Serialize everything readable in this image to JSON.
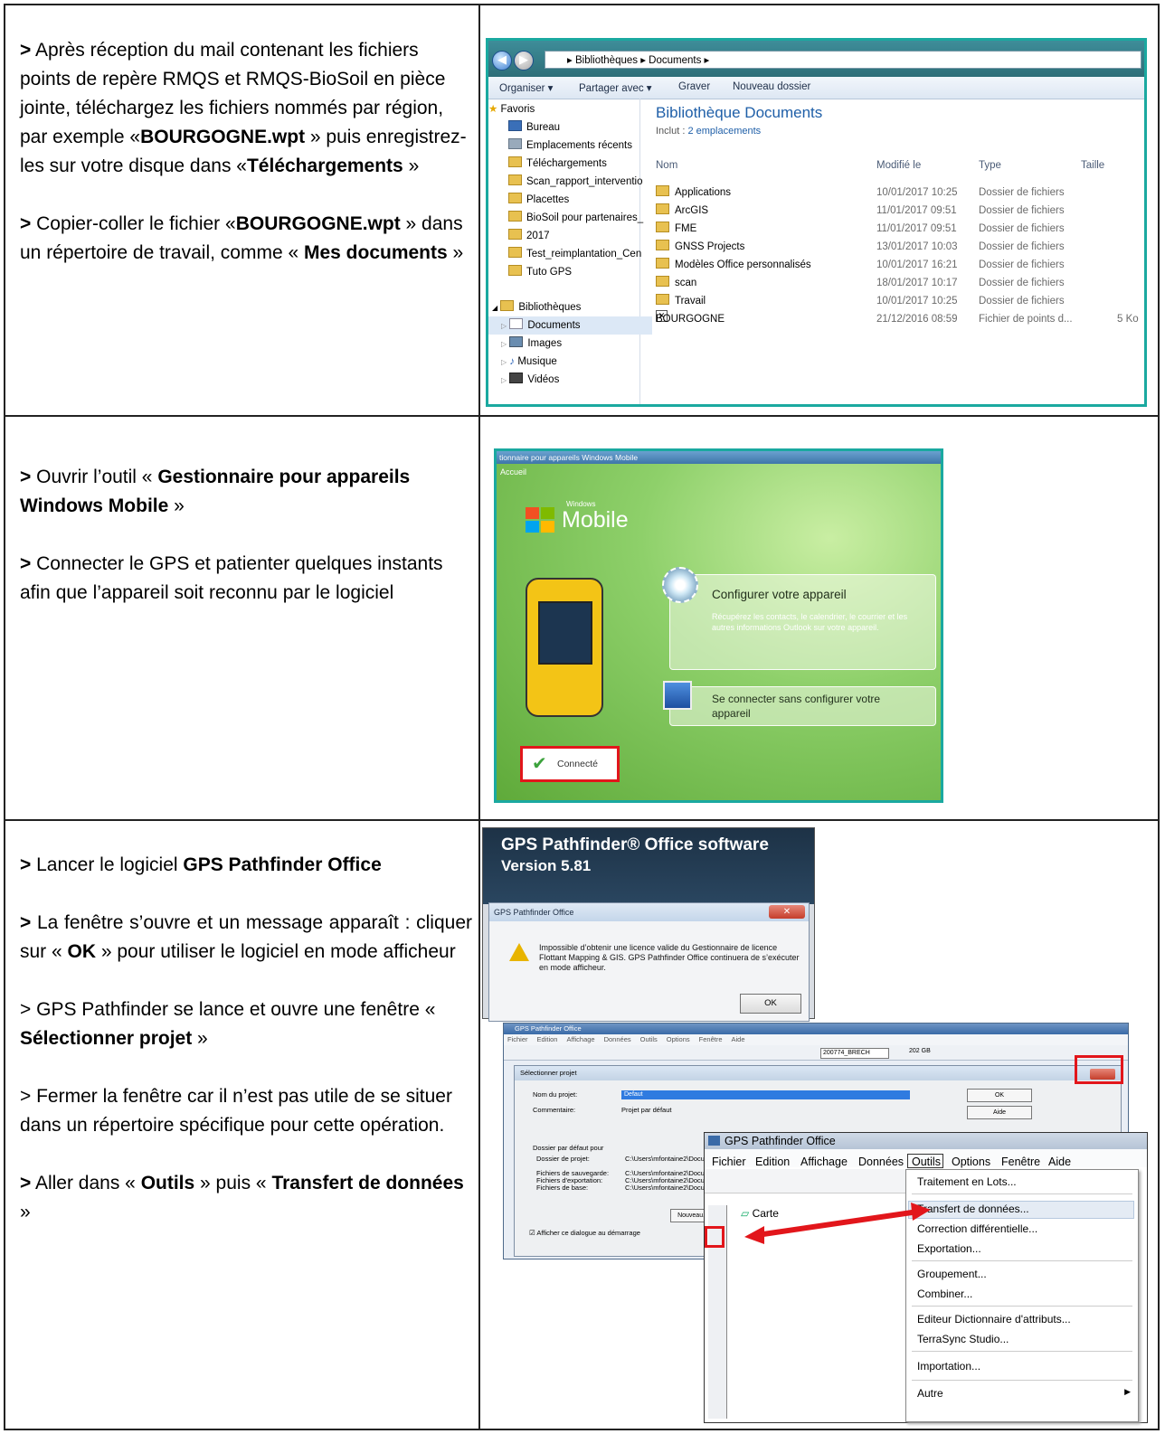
{
  "rows": [
    {
      "p1": "Après réception du mail contenant les fichiers points de repère RMQS et RMQS-BioSoil en pièce jointe, téléchargez les fichiers nommés par région, par exemple «",
      "p1_b1": "BOURGOGNE.wpt",
      "p1_m": " » puis enregistrez-les sur votre disque dans «",
      "p1_b2": "Téléchargements",
      "p1_e": " »",
      "p2": "Copier-coller le fichier «",
      "p2_b1": "BOURGOGNE.wpt",
      "p2_m": " » dans un répertoire de travail, comme « ",
      "p2_b2": "Mes documents",
      "p2_e": " »"
    },
    {
      "p1": "Ouvrir l’outil « ",
      "p1_b1": "Gestionnaire pour appareils Windows Mobile",
      "p1_e": " »",
      "p2": "Connecter le GPS et patienter quelques instants afin que l’appareil soit reconnu par le logiciel"
    },
    {
      "p1": "Lancer le logiciel ",
      "p1_b1": "GPS Pathfinder Office",
      "p2": "La fenêtre s’ouvre et un message apparaît : cliquer sur « ",
      "p2_b1": "OK",
      "p2_e": " » pour utiliser le logiciel en mode afficheur",
      "p3": "GPS Pathfinder se lance et ouvre une fenêtre « ",
      "p3_b1": "Sélectionner projet",
      "p3_e": " »",
      "p4": "Fermer la fenêtre car il n’est pas utile de se situer dans un répertoire spécifique pour cette opération.",
      "p5": "Aller dans « ",
      "p5_b1": "Outils",
      "p5_m": " » puis « ",
      "p5_b2": "Transfert de données",
      "p5_e": " »"
    }
  ],
  "bullet": ">",
  "explorer": {
    "address": "▸ Bibliothèques ▸ Documents ▸",
    "toolbar": [
      "Organiser ▾",
      "Partager avec ▾",
      "Graver",
      "Nouveau dossier"
    ],
    "nav": [
      "Favoris",
      "Bureau",
      "Emplacements récents",
      "Téléchargements",
      "Scan_rapport_interventio",
      "Placettes",
      "BioSoil pour partenaires_",
      "2017",
      "Test_reimplantation_Cen",
      "Tuto GPS",
      "Bibliothèques",
      "Documents",
      "Images",
      "Musique",
      "Vidéos"
    ],
    "library_title": "Bibliothèque Documents",
    "library_sub_prefix": "Inclut : ",
    "library_sub_link": "2 emplacements",
    "headers": [
      "Nom",
      "Modifié le",
      "Type",
      "Taille"
    ],
    "files": [
      {
        "name": "Applications",
        "date": "10/01/2017 10:25",
        "type": "Dossier de fichiers",
        "size": ""
      },
      {
        "name": "ArcGIS",
        "date": "11/01/2017 09:51",
        "type": "Dossier de fichiers",
        "size": ""
      },
      {
        "name": "FME",
        "date": "11/01/2017 09:51",
        "type": "Dossier de fichiers",
        "size": ""
      },
      {
        "name": "GNSS Projects",
        "date": "13/01/2017 10:03",
        "type": "Dossier de fichiers",
        "size": ""
      },
      {
        "name": "Modèles Office personnalisés",
        "date": "10/01/2017 16:21",
        "type": "Dossier de fichiers",
        "size": ""
      },
      {
        "name": "scan",
        "date": "18/01/2017 10:17",
        "type": "Dossier de fichiers",
        "size": ""
      },
      {
        "name": "Travail",
        "date": "10/01/2017 10:25",
        "type": "Dossier de fichiers",
        "size": ""
      },
      {
        "name": "BOURGOGNE",
        "date": "21/12/2016 08:59",
        "type": "Fichier de points d...",
        "size": "5 Ko"
      }
    ]
  },
  "wm": {
    "title": "tionnaire pour appareils Windows Mobile",
    "accueil": "Accueil",
    "logo_small": "Windows",
    "logo": "Mobile",
    "cfg_title": "Configurer votre appareil",
    "cfg_desc": "Récupérez les contacts, le calendrier, le courrier et les autres informations Outlook sur votre appareil.",
    "connect_title": "Se connecter sans configurer votre appareil",
    "status": "Connecté"
  },
  "pf": {
    "splash1": "GPS Pathfinder® Office software",
    "splash2": "Version 5.81",
    "dlg_title": "GPS Pathfinder Office",
    "dlg_msg": "Impossible d’obtenir une licence valide du Gestionnaire de licence Flottant Mapping & GIS. GPS Pathfinder Office continuera de s’exécuter en mode afficheur.",
    "ok": "OK",
    "main_title": "GPS Pathfinder Office",
    "main_menu": [
      "Fichier",
      "Edition",
      "Affichage",
      "Données",
      "Outils",
      "Options",
      "Fenêtre",
      "Aide"
    ],
    "combo": "200774_BRECH",
    "disk": "202 GB",
    "sp_title": "Sélectionner projet",
    "sp_name_label": "Nom du projet:",
    "sp_name": "Defaut",
    "sp_comment_label": "Commentaire:",
    "sp_comment": "Projet par défaut",
    "sp_ok": "OK",
    "sp_aide": "Aide",
    "sp_group": "Dossier par défaut pour",
    "sp_folders": [
      "Dossier de projet:",
      "Fichiers de sauvegarde:",
      "Fichiers d'exportation:",
      "Fichiers de base:"
    ],
    "sp_paths": [
      "C:\\Users\\mfontaine2\\Docume",
      "C:\\Users\\mfontaine2\\Docume",
      "C:\\Users\\mfontaine2\\Docume",
      "C:\\Users\\mfontaine2\\Docume"
    ],
    "sp_new": "Nouveau...",
    "sp_check": "Afficher ce dialogue au démarrage",
    "ow_title": "GPS Pathfinder Office",
    "ow_menu": [
      "Fichier",
      "Edition",
      "Affichage",
      "Données",
      "Outils",
      "Options",
      "Fenêtre",
      "Aide"
    ],
    "carte": "Carte",
    "tools_menu": [
      "Traitement en Lots...",
      "Transfert de données...",
      "Correction différentielle...",
      "Exportation...",
      "Groupement...",
      "Combiner...",
      "Editeur Dictionnaire d'attributs...",
      "TerraSync Studio...",
      "Importation...",
      "Autre"
    ]
  }
}
